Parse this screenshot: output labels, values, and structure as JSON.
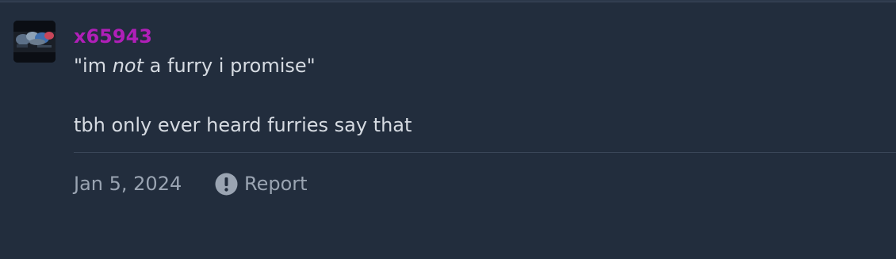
{
  "post": {
    "username": "x65943",
    "quote_open": "\"im ",
    "quote_emphasis": "not",
    "quote_close": " a furry i promise\"",
    "reply": "tbh only ever heard furries say that",
    "date": "Jan 5, 2024",
    "report_label": "Report"
  },
  "colors": {
    "background": "#222d3d",
    "username": "#b01fb8",
    "text": "#d6dbe2",
    "meta": "#9aa4b2"
  }
}
